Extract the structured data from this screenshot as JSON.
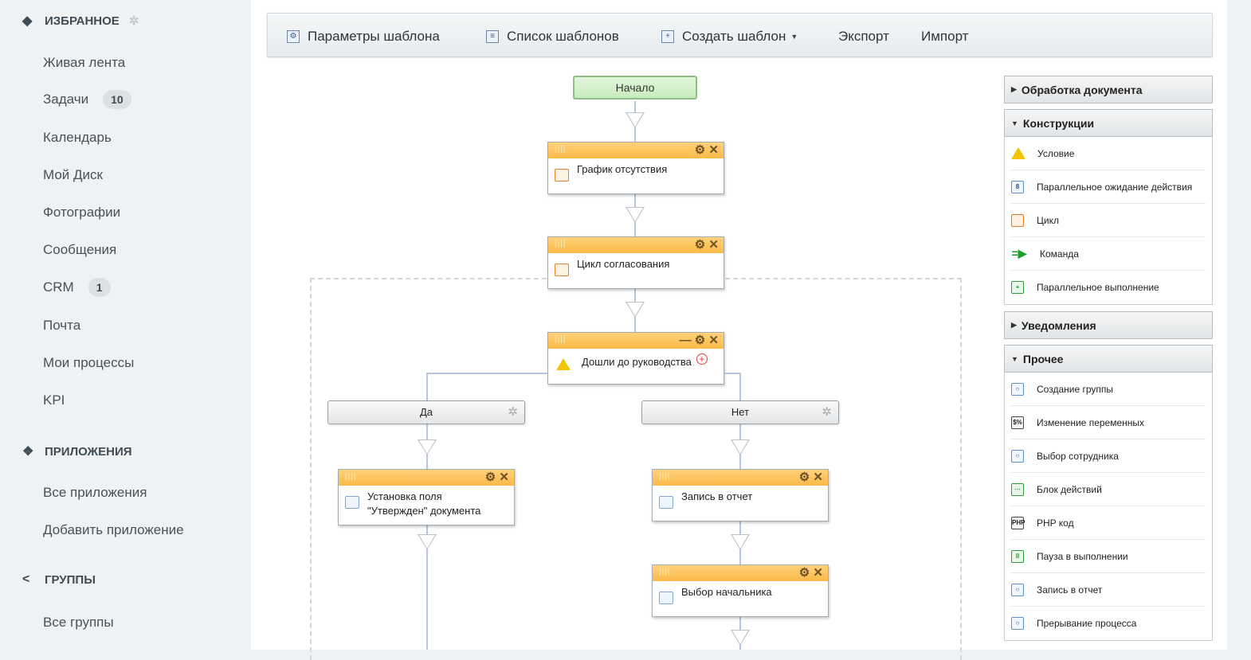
{
  "sidebar": {
    "favorites": {
      "title": "ИЗБРАННОЕ"
    },
    "items": [
      {
        "label": "Живая лента"
      },
      {
        "label": "Задачи",
        "badge": "10"
      },
      {
        "label": "Календарь"
      },
      {
        "label": "Мой Диск"
      },
      {
        "label": "Фотографии"
      },
      {
        "label": "Сообщения"
      },
      {
        "label": "CRM",
        "badge": "1"
      },
      {
        "label": "Почта"
      },
      {
        "label": "Мои процессы"
      },
      {
        "label": "KPI"
      }
    ],
    "apps": {
      "title": "ПРИЛОЖЕНИЯ",
      "items": [
        {
          "label": "Все приложения"
        },
        {
          "label": "Добавить приложение"
        }
      ]
    },
    "groups": {
      "title": "ГРУППЫ",
      "items": [
        {
          "label": "Все группы"
        }
      ]
    }
  },
  "toolbar": {
    "params": "Параметры шаблона",
    "list": "Список шаблонов",
    "create": "Создать шаблон",
    "export": "Экспорт",
    "import": "Импорт"
  },
  "flow": {
    "start": "Начало",
    "absence": "График отсутствия",
    "loop": "Цикл согласования",
    "condition": "Дошли до руководства",
    "yes": "Да",
    "no": "Нет",
    "set_field_1": "Установка поля",
    "set_field_2": "\"Утвержден\" документа",
    "report": "Запись в отчет",
    "choose_boss": "Выбор начальника"
  },
  "panel": {
    "doc_processing": "Обработка документа",
    "constructions": {
      "title": "Конструкции",
      "items": [
        "Условие",
        "Параллельное ожидание действия",
        "Цикл",
        "Команда",
        "Параллельное выполнение"
      ]
    },
    "notifications": "Уведомления",
    "other": {
      "title": "Прочее",
      "items": [
        "Создание группы",
        "Изменение переменных",
        "Выбор сотрудника",
        "Блок действий",
        "PHP код",
        "Пауза в выполнении",
        "Запись в отчет",
        "Прерывание процесса"
      ]
    }
  }
}
